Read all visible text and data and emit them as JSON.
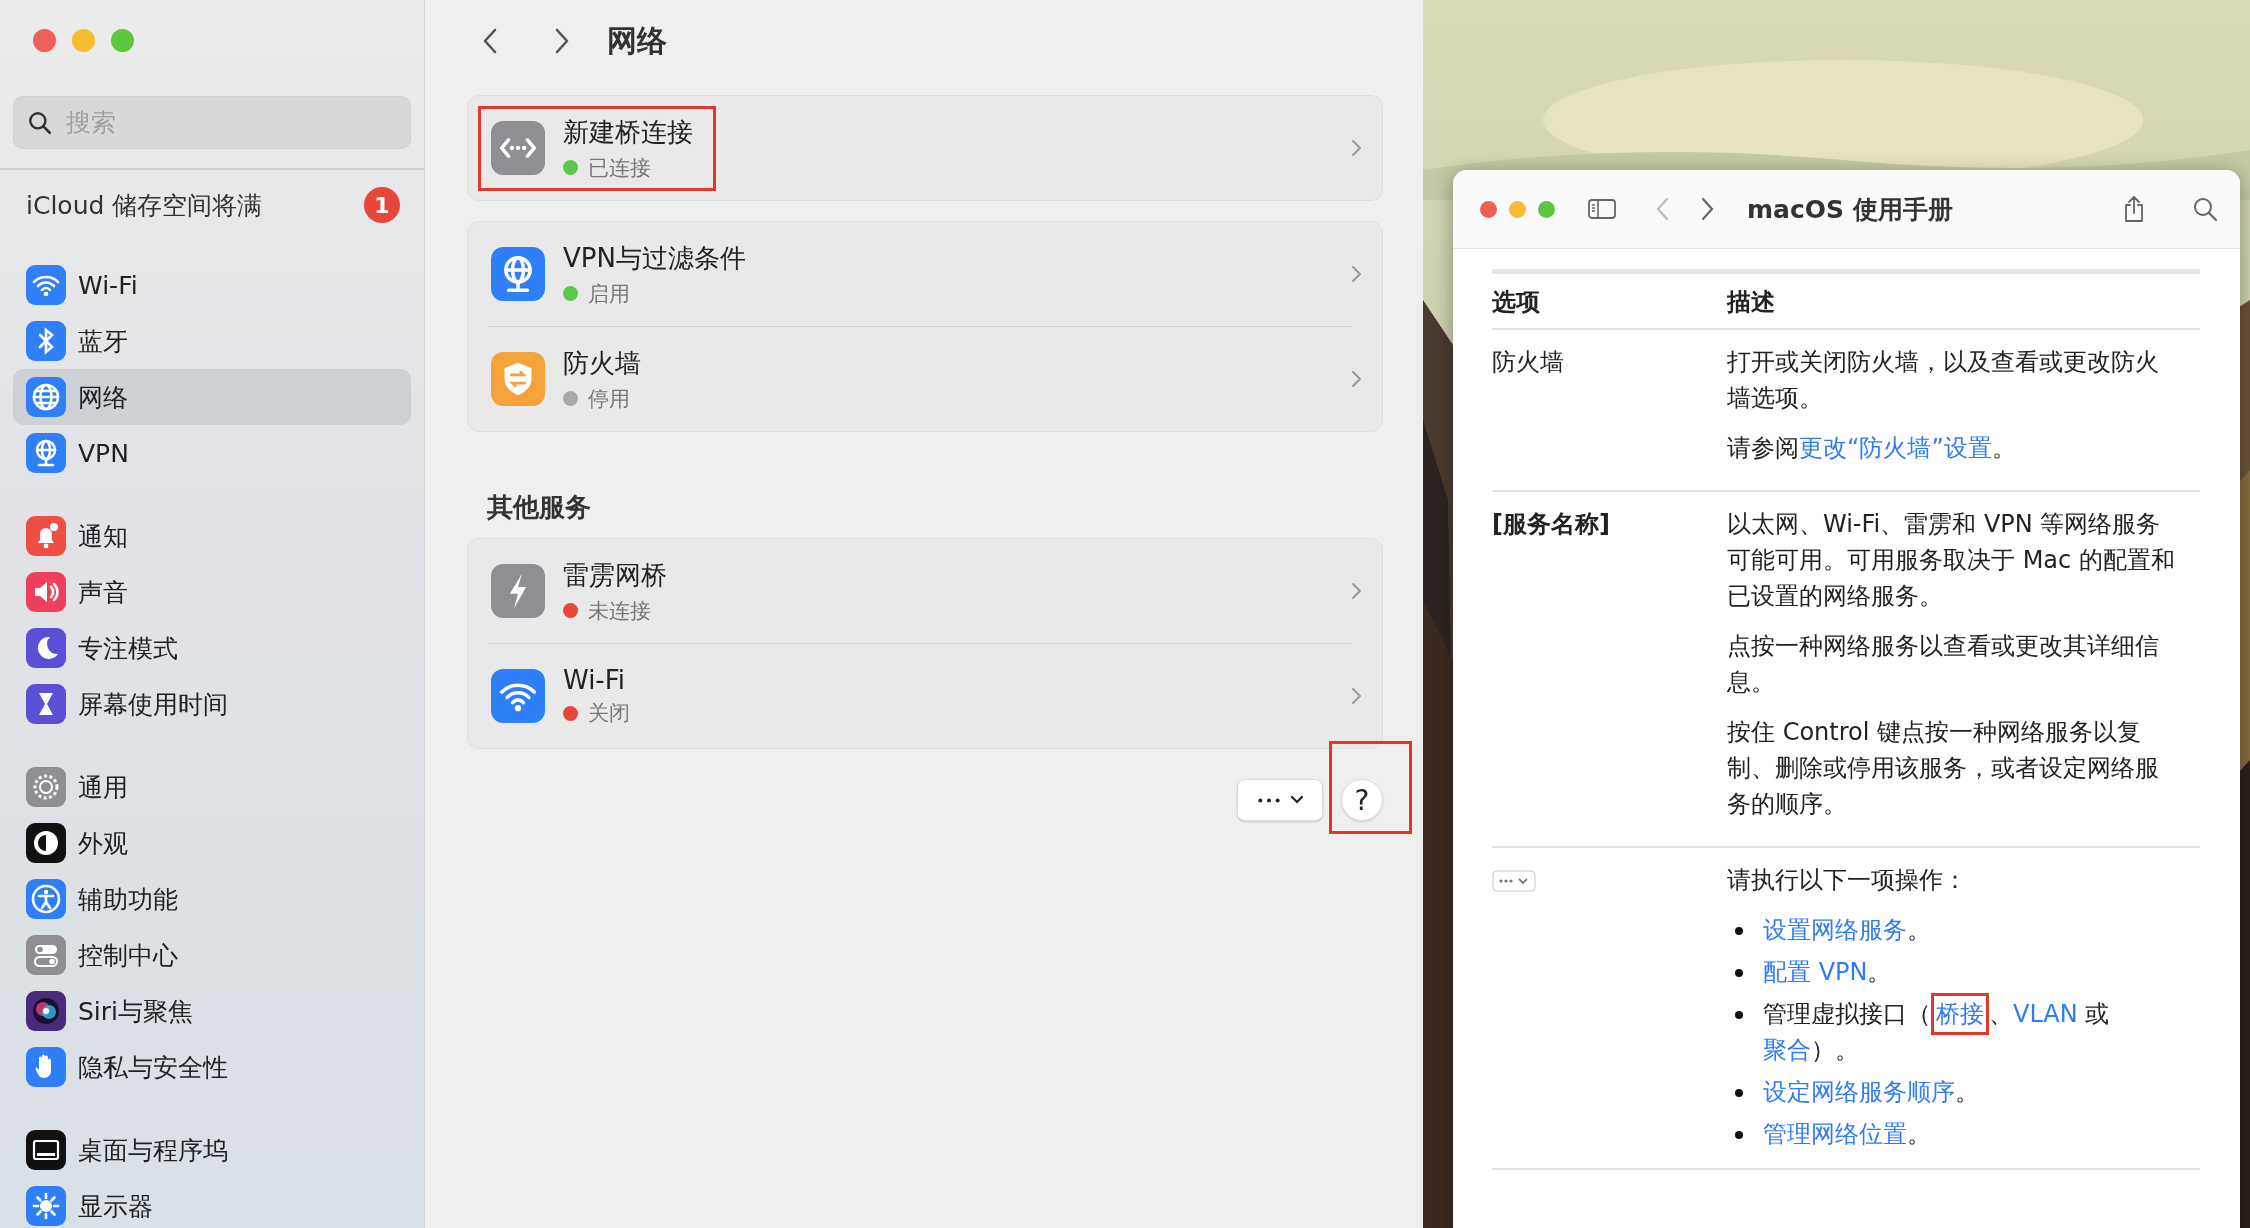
{
  "settings_window": {
    "search": {
      "placeholder": "搜索"
    },
    "notice": {
      "label": "iCloud 储存空间将满",
      "badge": "1"
    },
    "sidebar": {
      "groups": [
        [
          {
            "label": "Wi-Fi",
            "kind": "wifi",
            "selected": false
          },
          {
            "label": "蓝牙",
            "kind": "bluetooth",
            "selected": false
          },
          {
            "label": "网络",
            "kind": "globe",
            "selected": true
          },
          {
            "label": "VPN",
            "kind": "vpn",
            "selected": false
          }
        ],
        [
          {
            "label": "通知",
            "kind": "bell",
            "selected": false
          },
          {
            "label": "声音",
            "kind": "speaker",
            "selected": false
          },
          {
            "label": "专注模式",
            "kind": "moon",
            "selected": false
          },
          {
            "label": "屏幕使用时间",
            "kind": "hourglass",
            "selected": false
          }
        ],
        [
          {
            "label": "通用",
            "kind": "gear",
            "selected": false
          },
          {
            "label": "外观",
            "kind": "appearance",
            "selected": false
          },
          {
            "label": "辅助功能",
            "kind": "accessibility",
            "selected": false
          },
          {
            "label": "控制中心",
            "kind": "toggles",
            "selected": false
          },
          {
            "label": "Siri与聚焦",
            "kind": "siri",
            "selected": false
          },
          {
            "label": "隐私与安全性",
            "kind": "hand",
            "selected": false
          }
        ],
        [
          {
            "label": "桌面与程序坞",
            "kind": "dock",
            "selected": false
          },
          {
            "label": "显示器",
            "kind": "sun",
            "selected": false
          }
        ]
      ]
    },
    "title": "网络",
    "sections": [
      {
        "services": [
          {
            "name": "新建桥连接",
            "status": "已连接",
            "color": "#5ac84a",
            "kind": "bridge",
            "highlighted": true
          }
        ]
      },
      {
        "services": [
          {
            "name": "VPN与过滤条件",
            "status": "启用",
            "color": "#5ac84a",
            "kind": "vpn",
            "highlighted": false
          },
          {
            "name": "防火墙",
            "status": "停用",
            "color": "#a9a9a9",
            "kind": "shield",
            "highlighted": false
          }
        ]
      },
      {
        "heading": "其他服务",
        "services": [
          {
            "name": "雷雳网桥",
            "status": "未连接",
            "color": "#e8453c",
            "kind": "bolt",
            "highlighted": false
          },
          {
            "name": "Wi-Fi",
            "status": "关闭",
            "color": "#e8453c",
            "kind": "wifi",
            "highlighted": false
          }
        ]
      }
    ],
    "help_button": {
      "label": "?",
      "highlighted": true
    }
  },
  "help_window": {
    "title": "macOS 使用手册",
    "columns": [
      "选项",
      "描述"
    ],
    "rows": [
      {
        "kind": "text",
        "option": "防火墙",
        "bold": false,
        "paragraphs": [
          [
            {
              "text": "打开或关闭防火墙，以及查看或更改防火墙选项。"
            }
          ],
          [
            {
              "text": "请参阅"
            },
            {
              "text": "更改“防火墙”设置",
              "link": true
            },
            {
              "text": "。"
            }
          ]
        ]
      },
      {
        "kind": "text",
        "option": "[服务名称]",
        "bold": true,
        "paragraphs": [
          [
            {
              "text": "以太网、Wi-Fi、雷雳和 VPN 等网络服务可能可用。可用服务取决于 Mac 的配置和已设置的网络服务。"
            }
          ],
          [
            {
              "text": "点按一种网络服务以查看或更改其详细信息。"
            }
          ],
          [
            {
              "text": "按住 Control 键点按一种网络服务以复制、删除或停用该服务，或者设定网络服务的顺序。"
            }
          ]
        ]
      },
      {
        "kind": "menu_button",
        "paragraphs": [
          [
            {
              "text": "请执行以下一项操作："
            }
          ]
        ],
        "bullets": [
          [
            {
              "text": "设置网络服务",
              "link": true
            },
            {
              "text": "。"
            }
          ],
          [
            {
              "text": "配置 VPN",
              "link": true
            },
            {
              "text": "。"
            }
          ],
          [
            {
              "text": "管理虚拟接口（"
            },
            {
              "text": "桥接",
              "link": true,
              "highlighted": true
            },
            {
              "text": "、"
            },
            {
              "text": "VLAN",
              "link": true
            },
            {
              "text": " 或"
            },
            {
              "text": "聚合",
              "link": true
            },
            {
              "text": "）。"
            }
          ],
          [
            {
              "text": "设定网络服务顺序",
              "link": true
            },
            {
              "text": "。"
            }
          ],
          [
            {
              "text": "管理网络位置",
              "link": true
            },
            {
              "text": "。"
            }
          ]
        ]
      }
    ]
  }
}
